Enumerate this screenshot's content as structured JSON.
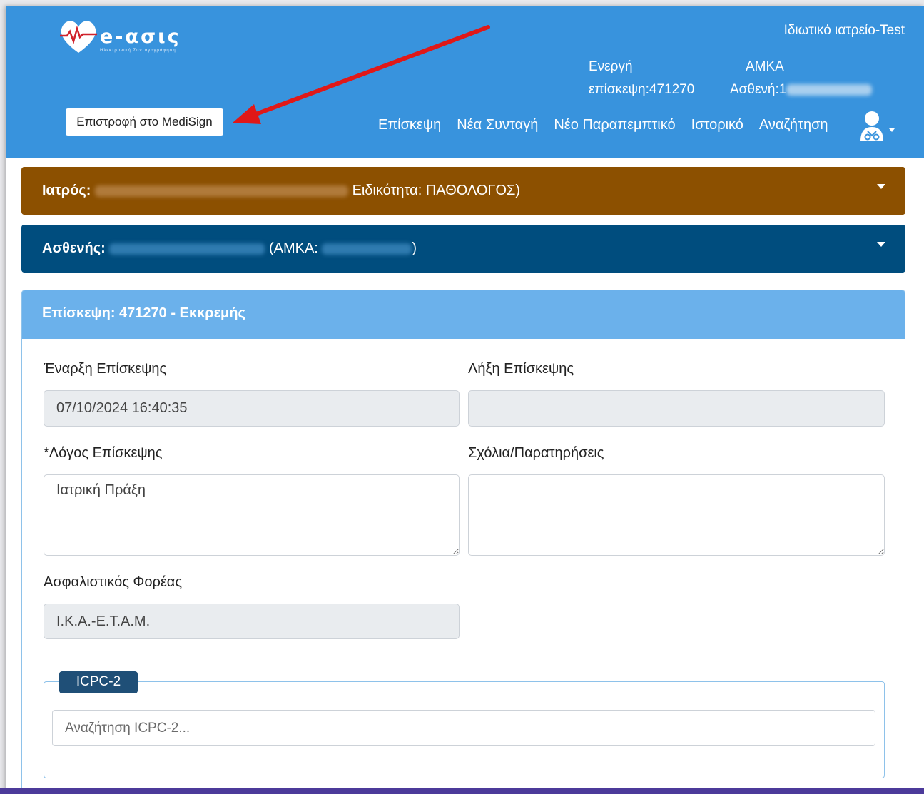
{
  "header": {
    "logo_text": "e-ασις",
    "logo_subtitle": "Ηλεκτρονική Συνταγογράφηση",
    "clinic": "Ιδιωτικό ιατρείο-Test",
    "visit_line1": "Ενεργή",
    "visit_line2": "επίσκεψη:471270",
    "amka_line1": "ΑΜΚΑ",
    "amka_line2": "Ασθενή:1",
    "return_button": "Επιστροφή στο MediSign",
    "nav": [
      "Επίσκεψη",
      "Νέα Συνταγή",
      "Νέο Παραπεμπτικό",
      "Ιστορικό",
      "Αναζήτηση"
    ],
    "user_icon": "doctor-icon",
    "color": "#3893dd"
  },
  "doctor_bar": {
    "label": "Ιατρός:",
    "specialty": "Ειδικότητα: ΠΑΘΟΛΟΓΟΣ)",
    "color": "#8c5000"
  },
  "patient_bar": {
    "label": "Ασθενής:",
    "amka_label": "(ΑΜΚΑ:",
    "amka_close": ")",
    "color": "#004d7e"
  },
  "visit": {
    "title": "Επίσκεψη: 471270 - Εκκρεμής",
    "start_label": "Έναρξη Επίσκεψης",
    "start_value": "07/10/2024 16:40:35",
    "end_label": "Λήξη Επίσκεψης",
    "end_value": "",
    "reason_label": "*Λόγος Επίσκεψης",
    "reason_value": "Ιατρική Πράξη",
    "comments_label": "Σχόλια/Παρατηρήσεις",
    "comments_value": "",
    "insurer_label": "Ασφαλιστικός Φορέας",
    "insurer_value": "I.K.A.-E.T.A.M.",
    "icpc_legend": "ICPC-2",
    "icpc_placeholder": "Αναζήτηση ICPC-2..."
  }
}
